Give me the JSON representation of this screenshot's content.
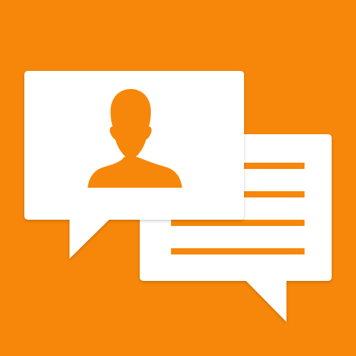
{
  "icon": {
    "name": "chat-messages-app-icon",
    "colors": {
      "background": "#F7870A",
      "bubble": "#FFFFFF",
      "accent": "#F7870A"
    },
    "parts": {
      "front_bubble_icon": "user-profile-icon",
      "back_bubble_icon": "text-lines-icon",
      "text_line_count": 4
    }
  }
}
